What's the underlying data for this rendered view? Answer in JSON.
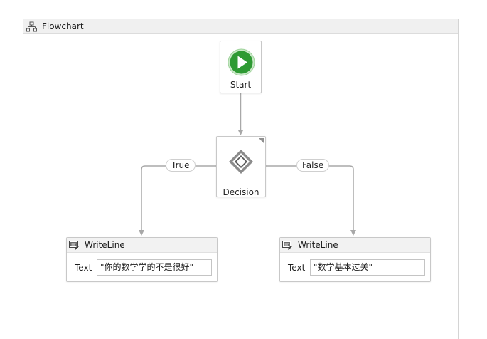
{
  "flowchart": {
    "title": "Flowchart"
  },
  "start": {
    "label": "Start",
    "icon": "play-icon",
    "color": "#2e9a33"
  },
  "decision": {
    "label": "Decision",
    "icon": "diamond-icon"
  },
  "branches": {
    "true_label": "True",
    "false_label": "False"
  },
  "writeline_true": {
    "title": "WriteLine",
    "text_label": "Text",
    "text_value": "\"你的数学学的不是很好\""
  },
  "writeline_false": {
    "title": "WriteLine",
    "text_label": "Text",
    "text_value": "\"数学基本过关\""
  },
  "colors": {
    "connector": "#a8a8a8",
    "node_border": "#c8c8c8",
    "header_bg": "#f0f0f0"
  }
}
